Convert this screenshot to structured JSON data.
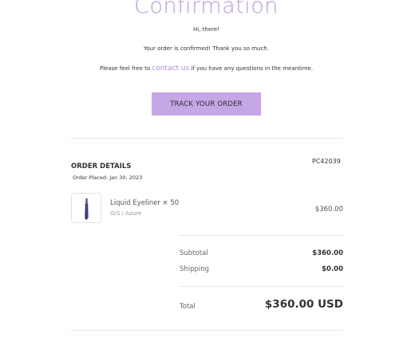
{
  "header": {
    "title": "Confirmation"
  },
  "message": {
    "greeting": "Hi, there!",
    "confirmed": "Your order is confirmed! Thank you so much.",
    "feel_free_prefix": "Please feel free to",
    "contact_link": "contact us",
    "feel_free_suffix": "if you have any questions in the meantime."
  },
  "actions": {
    "track_label": "TRACK YOUR ORDER"
  },
  "order": {
    "section_title": "ORDER DETAILS",
    "placed": "Order Placed: Jan 30, 2023",
    "number": "PC42039",
    "items": [
      {
        "name": "Liquid Eyeliner × 50",
        "variant": "O/S / Azure",
        "price": "$360.00",
        "image_icon": "eyeliner-product-icon"
      }
    ]
  },
  "summary": {
    "subtotal_label": "Subtotal",
    "subtotal_value": "$360.00",
    "shipping_label": "Shipping",
    "shipping_value": "$0.00",
    "total_label": "Total",
    "total_value": "$360.00 USD"
  },
  "colors": {
    "accent": "#b79be0",
    "button": "#c5a7e6",
    "link": "#b08be0"
  }
}
